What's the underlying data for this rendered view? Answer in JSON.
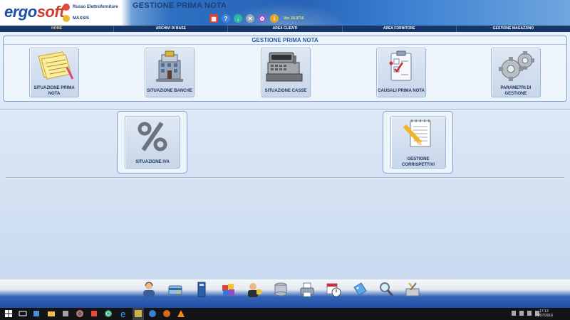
{
  "header": {
    "logo_part1": "ergo",
    "logo_part2": "soft",
    "company_name": "Russo Elettroforniture",
    "username": "MAXSIS",
    "app_title": "GESTIONE PRIMA NOTA",
    "version": "Ver. 16.0710",
    "toolbar_icons": [
      "calculator-icon",
      "help-icon",
      "download-icon",
      "close-icon",
      "settings-icon",
      "info-icon"
    ]
  },
  "menubar": {
    "items": [
      {
        "label": "HOME"
      },
      {
        "label": "ARCHIVI DI BASE"
      },
      {
        "label": "AREA CLIENTI"
      },
      {
        "label": "AREA FORNITORE"
      },
      {
        "label": "GESTIONE MAGAZZINO"
      }
    ],
    "active_index": 0
  },
  "main": {
    "panel_title": "GESTIONE PRIMA NOTA",
    "tiles": [
      {
        "line1": "SITUAZIONE PRIMA",
        "line2": "NOTA",
        "icon": "notepad-icon"
      },
      {
        "line1": "SITUAZIONE BANCHE",
        "line2": "",
        "icon": "bank-building-icon"
      },
      {
        "line1": "SITUAZIONE CASSE",
        "line2": "",
        "icon": "cash-register-icon"
      },
      {
        "line1": "CAUSALI PRIMA NOTA",
        "line2": "",
        "icon": "checklist-icon"
      },
      {
        "line1": "PARAMETRI DI",
        "line2": "GESTIONE",
        "icon": "gears-icon"
      }
    ],
    "tiles_row2": [
      {
        "line1": "SITUAZIONE IVA",
        "line2": "",
        "icon": "percent-icon"
      },
      {
        "line1": "GESTIONE",
        "line2": "CORRISPETTIVI",
        "icon": "notepad-pencil-icon"
      }
    ]
  },
  "dock": {
    "icons": [
      "user-support-icon",
      "credit-card-icon",
      "book-icon",
      "apps-icon",
      "security-user-icon",
      "database-icon",
      "printer-icon",
      "calendar-clock-icon",
      "tag-icon",
      "search-magnifier-icon",
      "toolbox-icon"
    ]
  },
  "taskbar": {
    "time": "17:13",
    "date": "21/07/2016"
  },
  "colors": {
    "header_blue": "#2663b6",
    "menubar_bg": "#17376a",
    "active_menu": "#f2d460",
    "tile_text": "#1f3358",
    "panel_title": "#2a5aa5"
  }
}
